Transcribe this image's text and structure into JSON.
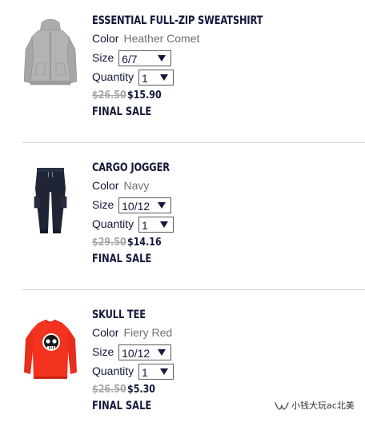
{
  "labels": {
    "color": "Color",
    "size": "Size",
    "quantity": "Quantity"
  },
  "items": [
    {
      "name": "ESSENTIAL FULL-ZIP SWEATSHIRT",
      "color": "Heather Comet",
      "size": "6/7",
      "quantity": "1",
      "original_price": "$26.50",
      "sale_price": "$15.90",
      "notice": "FINAL SALE",
      "thumbnail_icon": "gray-zip-hoodie-icon",
      "thumbnail_color": "#a9abad"
    },
    {
      "name": "CARGO JOGGER",
      "color": "Navy",
      "size": "10/12",
      "quantity": "1",
      "original_price": "$29.50",
      "sale_price": "$14.16",
      "notice": "FINAL SALE",
      "thumbnail_icon": "navy-jogger-pants-icon",
      "thumbnail_color": "#1f2535"
    },
    {
      "name": "SKULL TEE",
      "color": "Fiery Red",
      "size": "10/12",
      "quantity": "1",
      "original_price": "$26.50",
      "sale_price": "$5.30",
      "notice": "FINAL SALE",
      "thumbnail_icon": "red-skull-longsleeve-tee-icon",
      "thumbnail_color": "#f3321f"
    }
  ],
  "watermark": {
    "text": "小钱大玩ac北美",
    "icon": "wechat-channel-logo-icon"
  },
  "colors": {
    "text_primary": "#14183a",
    "text_secondary": "#707070",
    "strikethrough": "#a7a7a7",
    "divider": "#d7d7d7"
  }
}
